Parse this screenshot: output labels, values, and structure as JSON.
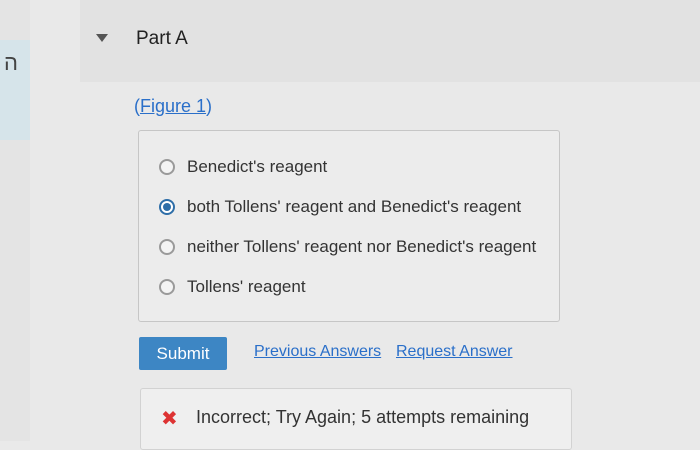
{
  "part": {
    "title": "Part A"
  },
  "figure": {
    "open": "(",
    "label": "Figure 1",
    "close": ")"
  },
  "question": {
    "options": [
      {
        "label": "Benedict's reagent",
        "selected": false
      },
      {
        "label": "both Tollens' reagent and Benedict's reagent",
        "selected": true
      },
      {
        "label": "neither Tollens' reagent nor Benedict's reagent",
        "selected": false
      },
      {
        "label": "Tollens' reagent",
        "selected": false
      }
    ]
  },
  "actions": {
    "submit_label": "Submit",
    "previous_answers_label": "Previous Answers",
    "request_answer_label": "Request Answer"
  },
  "feedback": {
    "icon": "x-icon",
    "text": "Incorrect; Try Again; 5 attempts remaining"
  },
  "colors": {
    "accent": "#3d86c4",
    "link": "#2a6fc9",
    "error": "#dd3333"
  }
}
